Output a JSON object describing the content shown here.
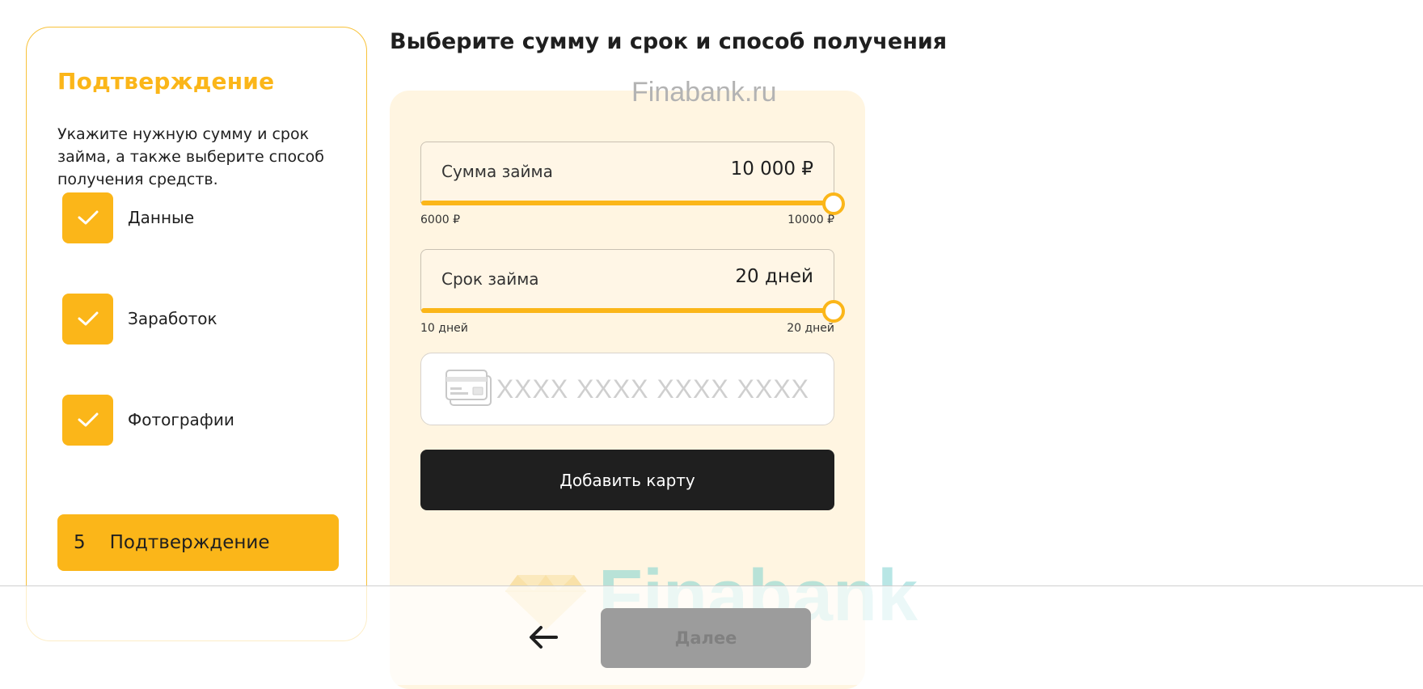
{
  "steps": {
    "title": "Подтверждение",
    "description": "Укажите нужную сумму и срок займа, а также выберите способ получения средств.",
    "completed": [
      {
        "label": "Данные"
      },
      {
        "label": "Заработок"
      },
      {
        "label": "Фотографии"
      }
    ],
    "active": {
      "number": "5",
      "label": "Подтверждение"
    }
  },
  "main": {
    "title": "Выберите сумму и срок и способ получения",
    "watermark_top": "Finabank.ru",
    "watermark_bottom": "Finabank"
  },
  "loan_amount": {
    "label": "Сумма займа",
    "value": "10 000 ₽",
    "min_label": "6000 ₽",
    "max_label": "10000 ₽",
    "level_fraction": 1.0
  },
  "loan_term": {
    "label": "Срок займа",
    "value": "20 дней",
    "min_label": "10 дней",
    "max_label": "20 дней",
    "level_fraction": 1.0
  },
  "card": {
    "icon": "credit-card-icon",
    "placeholder": "XXXX XXXX XXXX XXXX"
  },
  "add_card_label": "Добавить карту",
  "footer": {
    "back_icon": "arrow-left-icon",
    "next_label": "Далее"
  },
  "colors": {
    "accent": "#fbb619",
    "card_bg": "#fff5e1",
    "dark_button": "#1f1f1f",
    "disabled_button": "#9c9c9c"
  }
}
